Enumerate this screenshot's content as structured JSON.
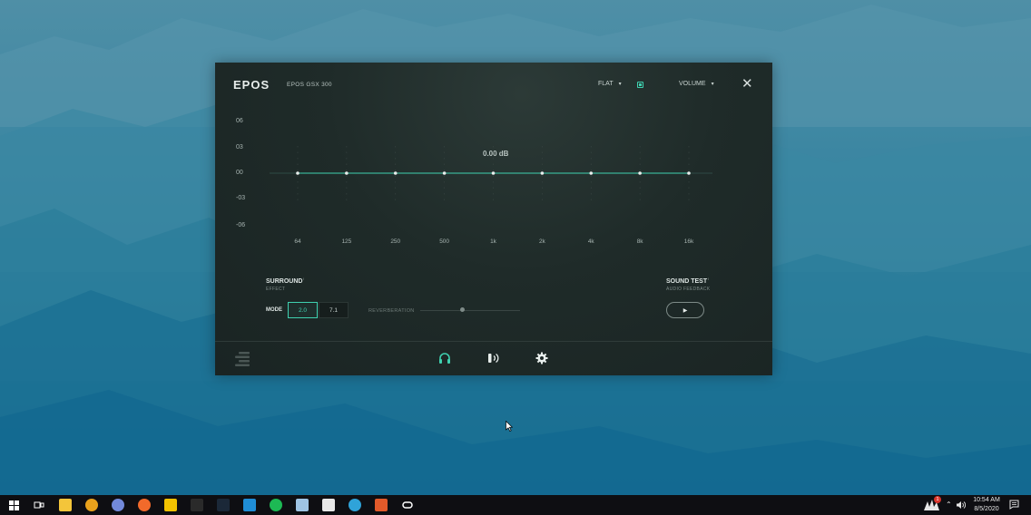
{
  "window": {
    "logo": "EPOS",
    "device_name": "EPOS GSX 300",
    "preset": {
      "label": "FLAT",
      "caret": "▾"
    },
    "volume": {
      "label": "VOLUME",
      "caret": "▾"
    },
    "close_glyph": "✕"
  },
  "equalizer": {
    "db_readout": "0.00 dB",
    "y_labels": [
      "06",
      "03",
      "00",
      "-03",
      "-06"
    ],
    "bands": [
      {
        "freq": "64",
        "gain": 0
      },
      {
        "freq": "125",
        "gain": 0
      },
      {
        "freq": "250",
        "gain": 0
      },
      {
        "freq": "500",
        "gain": 0
      },
      {
        "freq": "1k",
        "gain": 0
      },
      {
        "freq": "2k",
        "gain": 0
      },
      {
        "freq": "4k",
        "gain": 0
      },
      {
        "freq": "8k",
        "gain": 0
      },
      {
        "freq": "16k",
        "gain": 0
      }
    ],
    "accent": "#3fd1b0"
  },
  "surround": {
    "title": "SURROUND",
    "subtitle": "EFFECT",
    "info_glyph": "ⁱ",
    "mode_label": "MODE",
    "modes": [
      "2.0",
      "7.1"
    ],
    "selected_mode": "2.0",
    "reverberation_label": "REVERBERATION",
    "reverberation_level": 0.42
  },
  "sound_test": {
    "title": "SOUND TEST",
    "subtitle": "AUDIO FEEDBACK",
    "info_glyph": "ⁱ",
    "play_glyph": "▶"
  },
  "footer": {
    "icons": [
      "menu-icon",
      "headphones-icon",
      "microphone-icon",
      "gear-icon"
    ]
  },
  "taskbar": {
    "time": "10:54 AM",
    "date": "8/5/2020",
    "notification_count": "1",
    "apps": [
      {
        "name": "start-icon",
        "color": "#ffffff"
      },
      {
        "name": "task-view-icon",
        "color": "#ffffff"
      },
      {
        "name": "file-explorer-icon",
        "color": "#f4c53a"
      },
      {
        "name": "chrome-icon",
        "color": "#e9a21c"
      },
      {
        "name": "discord-icon",
        "color": "#7289da"
      },
      {
        "name": "origin-icon",
        "color": "#f26a2b"
      },
      {
        "name": "rockstar-icon",
        "color": "#f2c200"
      },
      {
        "name": "epic-games-icon",
        "color": "#2a2a2a"
      },
      {
        "name": "steam-icon",
        "color": "#1b2838"
      },
      {
        "name": "battlenet-icon",
        "color": "#1f8dd6"
      },
      {
        "name": "spotify-icon",
        "color": "#1db954"
      },
      {
        "name": "notepad-icon",
        "color": "#9fc4e4"
      },
      {
        "name": "clapper-icon",
        "color": "#e8e8e8"
      },
      {
        "name": "edge-icon",
        "color": "#2fa3d9"
      },
      {
        "name": "controller-icon",
        "color": "#e25a2a"
      },
      {
        "name": "oculus-icon",
        "color": "#ffffff"
      }
    ]
  }
}
